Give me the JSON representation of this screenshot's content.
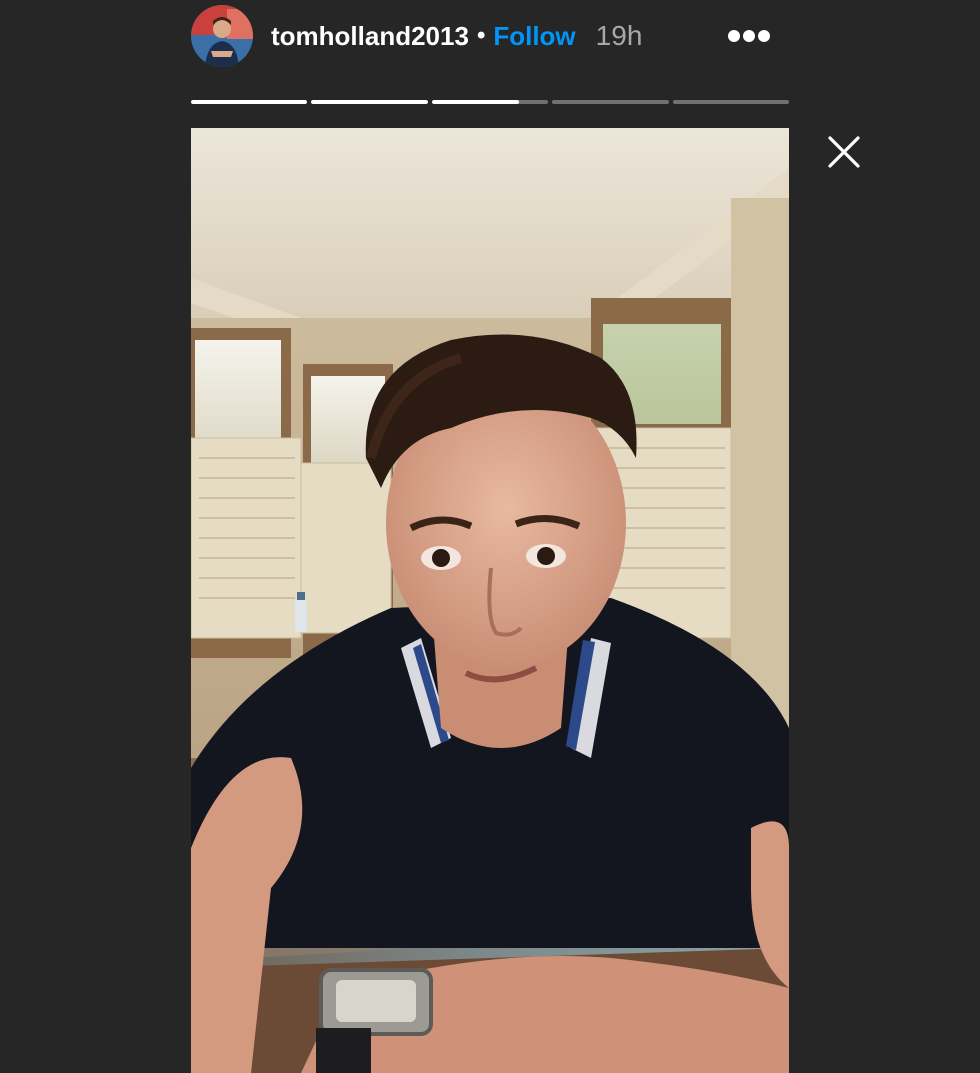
{
  "story": {
    "username": "tomholland2013",
    "separator": "•",
    "follow_label": "Follow",
    "time_ago": "19h"
  },
  "progress": {
    "segments": [
      1,
      1,
      0.75,
      0,
      0
    ]
  },
  "icons": {
    "avatar": "profile-avatar",
    "more": "more-options-icon",
    "close": "close-icon"
  },
  "colors": {
    "background": "#262626",
    "follow": "#0095f6",
    "time": "#a8a8a8"
  }
}
